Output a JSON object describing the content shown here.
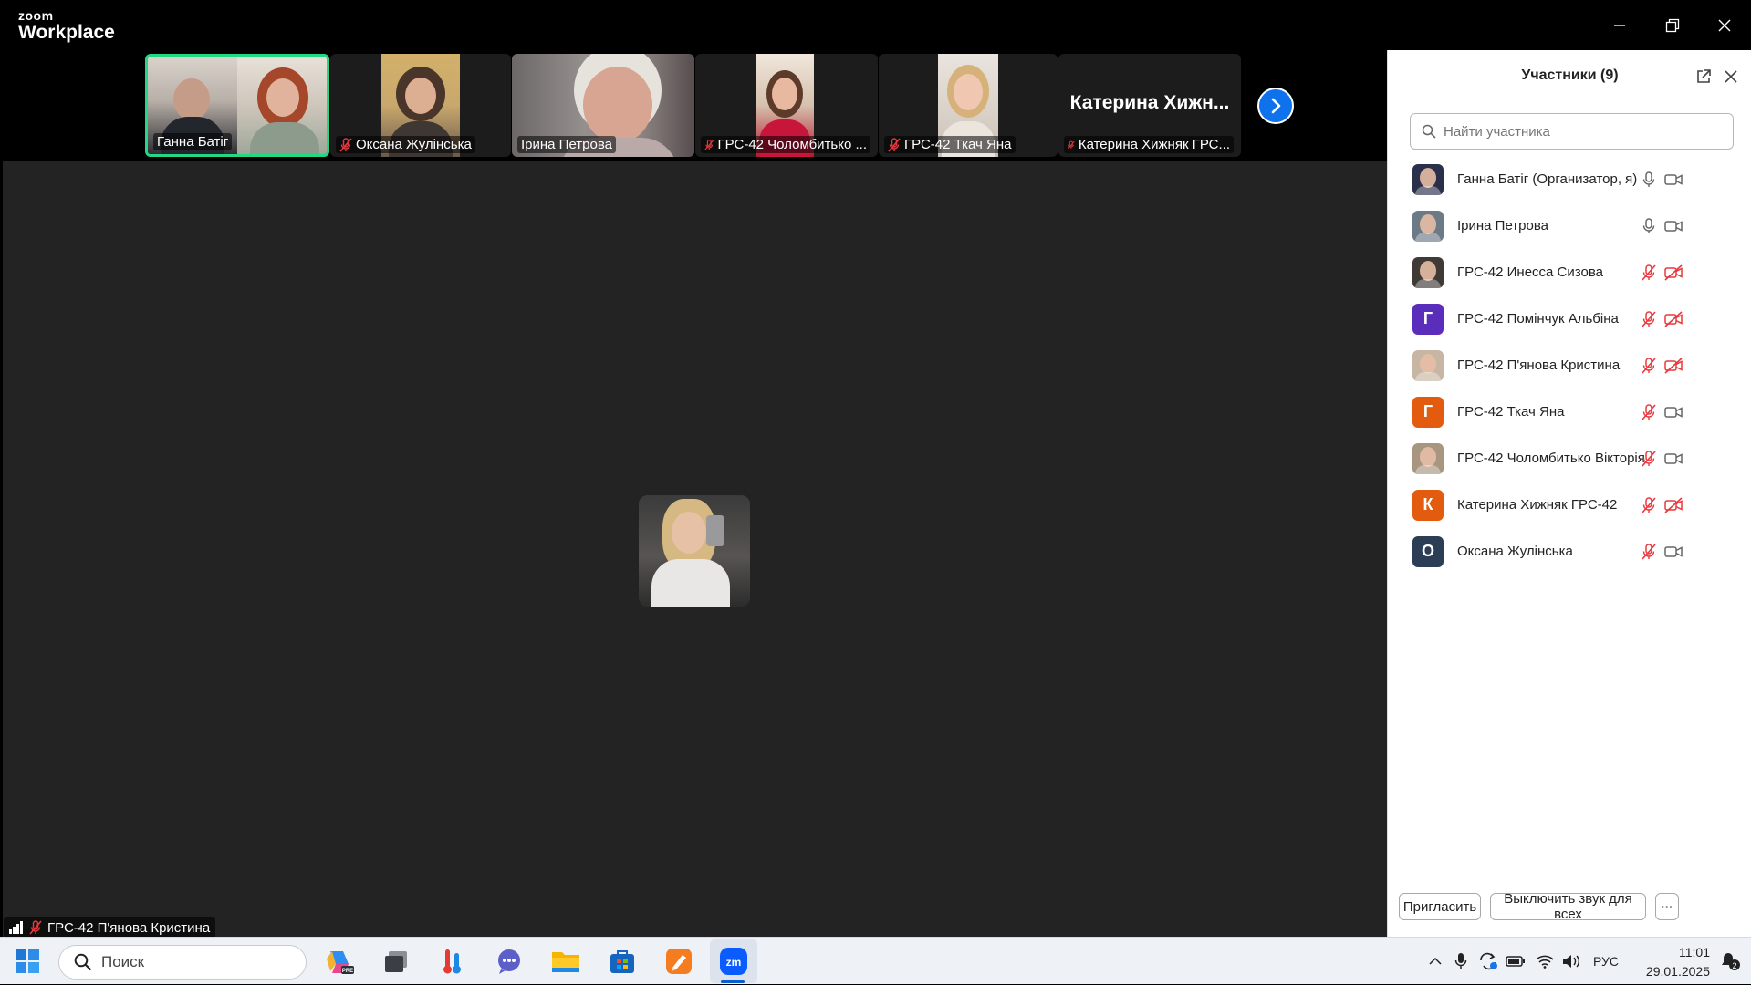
{
  "window": {
    "brand_small": "zoom",
    "brand_large": "Workplace",
    "controls": [
      "minimize",
      "restore",
      "close"
    ]
  },
  "strip": {
    "tiles": [
      {
        "name": "Ганна Батіг",
        "muted": false,
        "active": true
      },
      {
        "name": "Оксана Жулінська",
        "muted": true,
        "active": false
      },
      {
        "name": "Ірина Петрова",
        "muted": false,
        "active": false
      },
      {
        "name": "ГРС-42 Чоломбитько ...",
        "muted": true,
        "active": false
      },
      {
        "name": "ГРС-42 Ткач Яна",
        "muted": true,
        "active": false
      },
      {
        "name": "Катерина Хижняк ГРС...",
        "muted": true,
        "active": false,
        "video_off_label": "Катерина  Хижн..."
      }
    ],
    "next_icon": "chevron-right-icon"
  },
  "stage": {
    "speaker_label": "ГРС-42 П'янова Кристина",
    "speaker_muted": true,
    "signal_icon": "signal-bars-icon"
  },
  "panel": {
    "title": "Участники (9)",
    "search_placeholder": "Найти участника",
    "participants": [
      {
        "name": "Ганна Батіг (Организатор, я)",
        "avatar": "photo",
        "avatar_color": "#2a2f4a",
        "mic": "on",
        "video": "on"
      },
      {
        "name": "Ірина Петрова",
        "avatar": "photo",
        "avatar_color": "#6c7a86",
        "mic": "on",
        "video": "on"
      },
      {
        "name": "ГРС-42 Инесса Сизова",
        "avatar": "photo",
        "avatar_color": "#3f3a36",
        "mic": "off",
        "video": "off"
      },
      {
        "name": "ГРС-42 Помінчук Альбіна",
        "avatar": "Г",
        "avatar_color": "#5b2dbb",
        "mic": "off",
        "video": "off"
      },
      {
        "name": "ГРС-42 П'янова Кристина",
        "avatar": "photo",
        "avatar_color": "#c7b6a3",
        "mic": "off",
        "video": "off"
      },
      {
        "name": "ГРС-42 Ткач Яна",
        "avatar": "Г",
        "avatar_color": "#e35b0e",
        "mic": "off",
        "video": "on"
      },
      {
        "name": "ГРС-42 Чоломбитько Вікторія",
        "avatar": "photo",
        "avatar_color": "#a89680",
        "mic": "off",
        "video": "on"
      },
      {
        "name": "Катерина Хижняк ГРС-42",
        "avatar": "К",
        "avatar_color": "#e35b0e",
        "mic": "off",
        "video": "off"
      },
      {
        "name": "Оксана Жулінська",
        "avatar": "О",
        "avatar_color": "#2c3e55",
        "mic": "off",
        "video": "on"
      }
    ],
    "invite_label": "Пригласить",
    "mute_all_label": "Выключить звук для всех",
    "more_label": "···"
  },
  "taskbar": {
    "search_placeholder": "Поиск",
    "apps": [
      "copilot-icon",
      "taskview-icon",
      "thermometer-app-icon",
      "chat-app-icon",
      "file-explorer-icon",
      "microsoft-store-icon",
      "pen-app-icon",
      "zoom-app-icon"
    ],
    "zoom_label": "zm",
    "language": "РУС",
    "time": "11:01",
    "date": "29.01.2025",
    "notifications": "2"
  }
}
